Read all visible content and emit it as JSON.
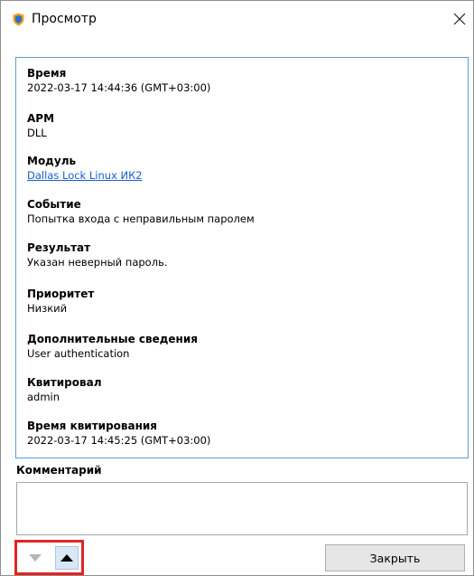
{
  "window": {
    "title": "Просмотр"
  },
  "event": [
    {
      "label": "Время",
      "value": "2022-03-17 14:44:36 (GMT+03:00)"
    },
    {
      "label": "АРМ",
      "value": "DLL"
    },
    {
      "label": "Модуль",
      "value": "Dallas Lock Linux ИК2",
      "is_link": true
    },
    {
      "label": "Событие",
      "value": "Попытка входа с неправильным паролем"
    },
    {
      "label": "Результат",
      "value": "Указан неверный пароль."
    },
    {
      "label": "Приоритет",
      "value": "Низкий"
    },
    {
      "label": "Дополнительные сведения",
      "value": "User authentication"
    },
    {
      "label": "Квитировал",
      "value": "admin"
    },
    {
      "label": "Время квитирования",
      "value": "2022-03-17 14:45:25 (GMT+03:00)"
    }
  ],
  "comment": {
    "label": "Комментарий",
    "value": ""
  },
  "footer": {
    "close_label": "Закрыть"
  },
  "colors": {
    "panel_border": "#5b9bd5",
    "link": "#1a5fd0",
    "highlight_frame": "#e02424",
    "icon_shield": "#f2a21b"
  }
}
